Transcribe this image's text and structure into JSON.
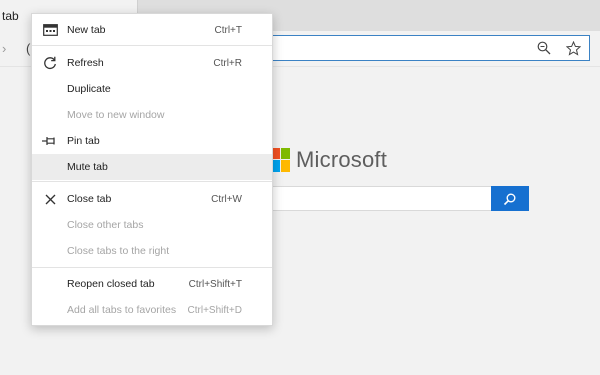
{
  "tab": {
    "label": "tab"
  },
  "page": {
    "brand": "Microsoft",
    "logo_colors": [
      "#f25022",
      "#7fba00",
      "#00a4ef",
      "#ffb900"
    ],
    "accent": "#1670d0"
  },
  "menu": {
    "new_tab": {
      "label": "New tab",
      "shortcut": "Ctrl+T",
      "icon": "new-tab-icon"
    },
    "refresh": {
      "label": "Refresh",
      "shortcut": "Ctrl+R",
      "icon": "refresh-icon"
    },
    "duplicate": {
      "label": "Duplicate"
    },
    "move_window": {
      "label": "Move to new window"
    },
    "pin_tab": {
      "label": "Pin tab",
      "icon": "pin-icon"
    },
    "mute_tab": {
      "label": "Mute tab"
    },
    "close_tab": {
      "label": "Close tab",
      "shortcut": "Ctrl+W",
      "icon": "close-icon"
    },
    "close_other": {
      "label": "Close other tabs"
    },
    "close_right": {
      "label": "Close tabs to the right"
    },
    "reopen_closed": {
      "label": "Reopen closed tab",
      "shortcut": "Ctrl+Shift+T"
    },
    "add_favorites": {
      "label": "Add all tabs to favorites",
      "shortcut": "Ctrl+Shift+D"
    }
  }
}
